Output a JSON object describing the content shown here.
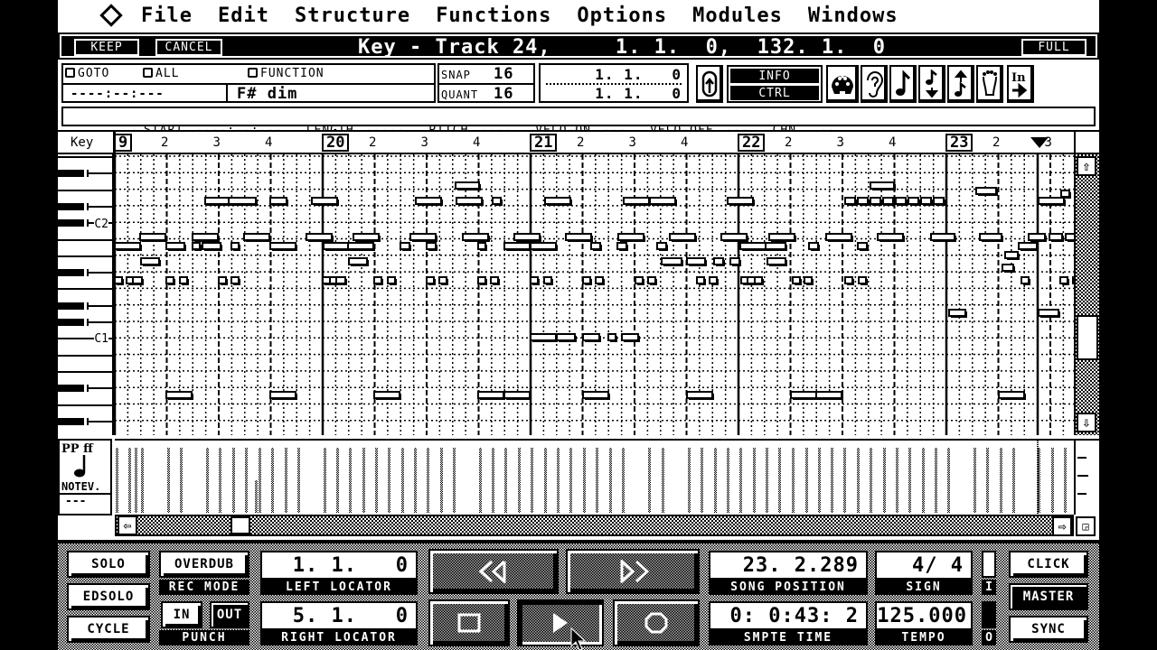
{
  "menu": {
    "logo": "diamond-logo",
    "items": [
      "File",
      "Edit",
      "Structure",
      "Functions",
      "Options",
      "Modules",
      "Windows"
    ]
  },
  "titlebar": {
    "keep": "KEEP",
    "cancel": "CANCEL",
    "title": "Key - Track 24,     1. 1.  0,  132. 1.  0",
    "full": "FULL"
  },
  "infobar": {
    "goto": "GOTO",
    "all": "ALL",
    "function": "FUNCTION",
    "goto_value": "----:--:---",
    "chord": "F# dim",
    "snap_label": "SNAP",
    "snap_value": "16",
    "quant_label": "QUANT",
    "quant_value": "16",
    "pos1": "1. 1.   0",
    "pos2": "1. 1.   0",
    "info": "INFO",
    "ctrl": "CTRL",
    "icons": [
      "loop-icon",
      "midi-plug-icon",
      "ear-icon",
      "note-icon",
      "note-down-icon",
      "note-up-icon",
      "foot-icon",
      "in-arrow-icon"
    ]
  },
  "eventline": {
    "start_label": "START",
    "start_value": "----:--:---",
    "length_label": "LENGTH",
    "length_value": "-----",
    "pitch_label": "PITCH",
    "pitch_value": "----",
    "velo_on_label": "VELO-ON",
    "velo_on_value": "---",
    "velo_off_label": "VELO-OFF",
    "velo_off_value": "---",
    "chn_label": "CHN",
    "chn_value": "--"
  },
  "ruler": {
    "key_label": "Key",
    "bars": [
      "9",
      "20",
      "21",
      "22",
      "23"
    ],
    "beats": [
      "2",
      "3",
      "4"
    ],
    "last_beat": "3"
  },
  "keyboard": {
    "labels": [
      {
        "name": "C2",
        "row": "c2"
      },
      {
        "name": "C1",
        "row": "c1"
      }
    ]
  },
  "velocity": {
    "label_top": "PP ff",
    "label_bottom": "NOTEV.",
    "value": "---"
  },
  "transport": {
    "solo": "SOLO",
    "edsolo": "EDSOLO",
    "cycle": "CYCLE",
    "overdub": "OVERDUB",
    "rec_mode": "REC MODE",
    "in": "IN",
    "out": "OUT",
    "punch": "PUNCH",
    "left_locator_value": "1. 1.   0",
    "left_locator": "LEFT LOCATOR",
    "right_locator_value": "5. 1.   0",
    "right_locator": "RIGHT LOCATOR",
    "song_position_value": "23. 2.289",
    "song_position": "SONG POSITION",
    "smpte_value": "0: 0:43: 2",
    "smpte": "SMPTE TIME",
    "sign_value": "4/ 4",
    "sign": "SIGN",
    "tempo_value": "125.000",
    "tempo": "TEMPO",
    "in_indicator": "I",
    "out_indicator": "O",
    "click": "CLICK",
    "master": "MASTER",
    "sync": "SYNC",
    "buttons": [
      "rewind",
      "fast-forward",
      "stop",
      "play",
      "record"
    ]
  },
  "notes": [
    {
      "bar": 0,
      "beat": 1.9,
      "len": 0.6,
      "row": 1
    },
    {
      "bar": 0,
      "beat": 2.5,
      "len": 0.5,
      "row": 3
    },
    {
      "bar": 1,
      "beat": 0.0,
      "len": 0.2,
      "row": 3
    },
    {
      "bar": 1,
      "beat": 0.5,
      "len": 0.5,
      "row": 3
    },
    {
      "bar": 1,
      "beat": 0.9,
      "len": 0.5,
      "row": 1
    },
    {
      "bar": 1,
      "beat": 1.7,
      "len": 0.1,
      "row": 3
    },
    {
      "bar": 1,
      "beat": 2.4,
      "len": 0.5,
      "row": 3
    },
    {
      "bar": 1,
      "beat": 2.4,
      "len": 0.5,
      "row": 1
    },
    {
      "bar": 2,
      "beat": 0.0,
      "len": 0.5,
      "row": 3
    },
    {
      "bar": 2,
      "beat": 1.1,
      "len": 0.5,
      "row": 3
    },
    {
      "bar": 2,
      "beat": 2.1,
      "len": 0.5,
      "row": 3
    },
    {
      "bar": 3,
      "beat": 2.5,
      "len": 0.5,
      "row": 3
    },
    {
      "bar": 3,
      "beat": 2.9,
      "len": 0.25,
      "row": 3
    },
    {
      "bar": 2,
      "beat": 0.0,
      "len": 0.2,
      "row": 0
    }
  ]
}
